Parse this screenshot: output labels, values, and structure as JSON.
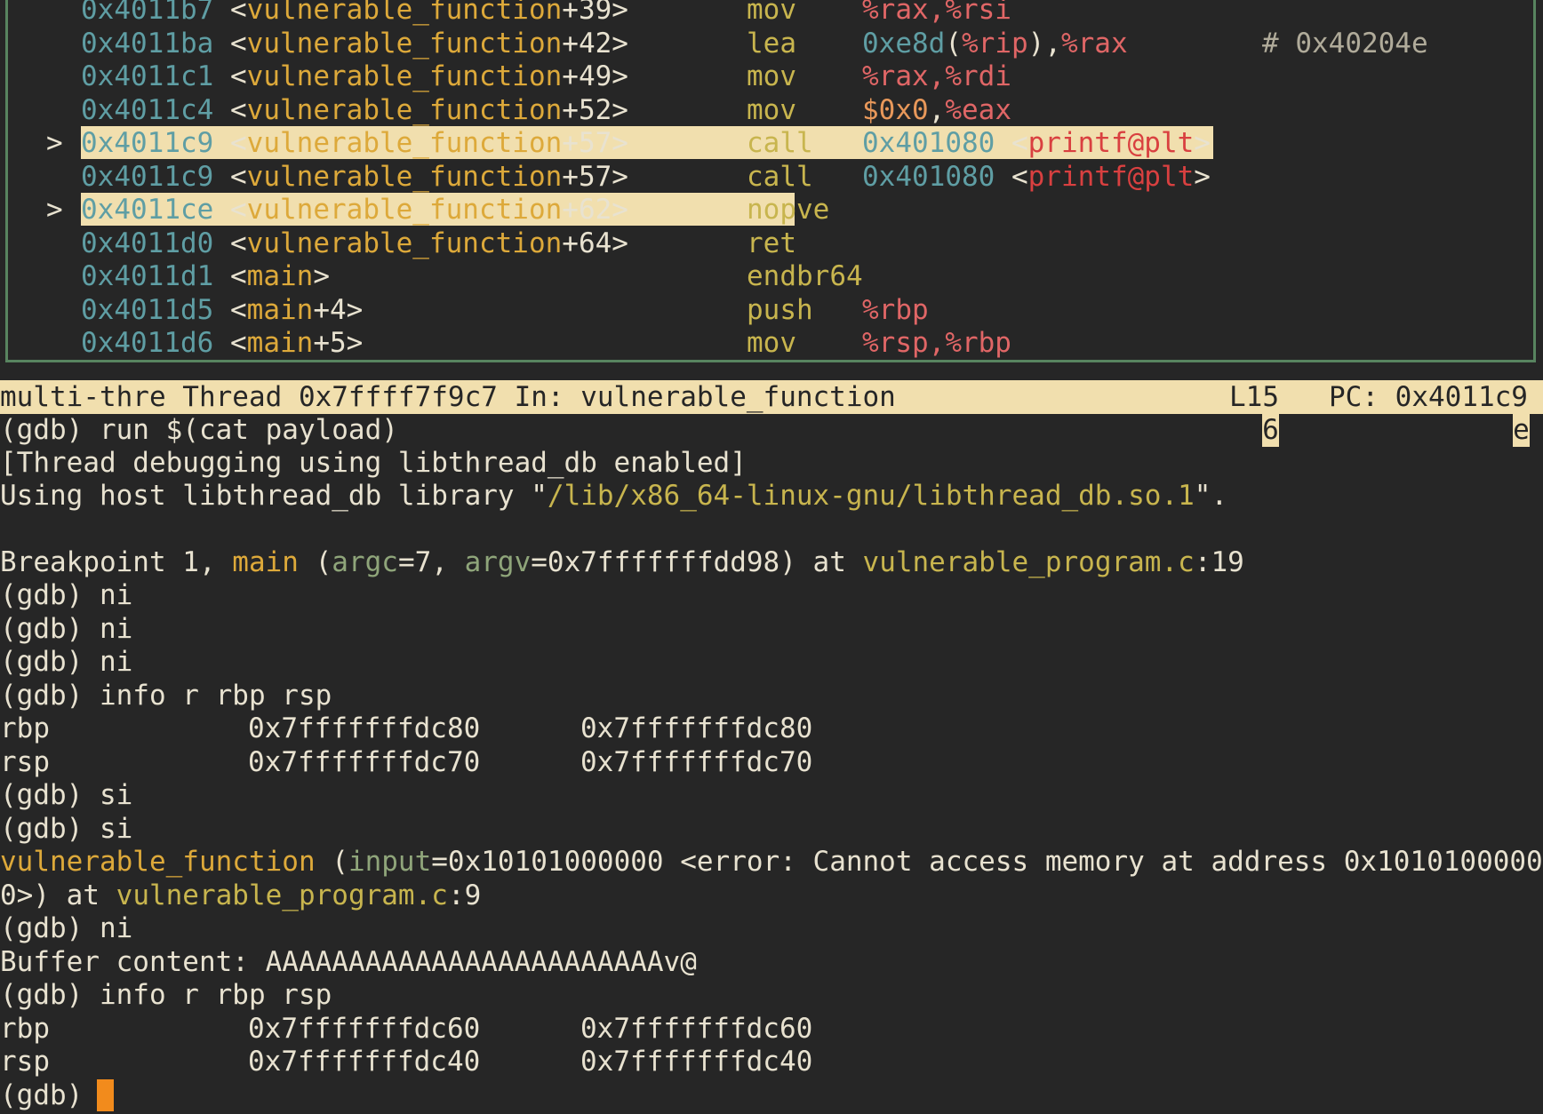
{
  "asm": {
    "rows": [
      {
        "marker": "",
        "addr": "0x4011b7",
        "sym": "vulnerable_function",
        "off": "+39",
        "mn": "mov",
        "op": "%rax,%rsi",
        "highlight": false,
        "cut": true
      },
      {
        "marker": "",
        "addr": "0x4011ba",
        "sym": "vulnerable_function",
        "off": "+42",
        "mn": "lea",
        "op_num": "0xe8d",
        "op_rest_a": "(",
        "op_reg_a": "%rip",
        "op_rest_b": "),",
        "op_reg_b": "%rax",
        "comment": "# 0x40204e",
        "highlight": false
      },
      {
        "marker": "",
        "addr": "0x4011c1",
        "sym": "vulnerable_function",
        "off": "+49",
        "mn": "mov",
        "op": "%rax,%rdi",
        "highlight": false
      },
      {
        "marker": "",
        "addr": "0x4011c4",
        "sym": "vulnerable_function",
        "off": "+52",
        "mn": "mov",
        "op_imm": "$0x0",
        "op_sep": ",",
        "op_reg": "%eax",
        "highlight": false
      },
      {
        "marker": ">",
        "addr": "0x4011c9",
        "sym": "vulnerable_function",
        "off": "+57",
        "mn": "call",
        "target": "0x401080",
        "plt": "printf@plt",
        "highlight": true
      },
      {
        "marker": "",
        "addr": "0x4011c9",
        "sym": "vulnerable_function",
        "off": "+57",
        "mn": "call",
        "target": "0x401080",
        "plt": "printf@plt",
        "highlight": false
      },
      {
        "marker": ">",
        "addr": "0x4011ce",
        "sym": "vulnerable_function",
        "off": "+62",
        "mn": "nop",
        "mn_tail": "ve",
        "highlight": true
      },
      {
        "marker": "",
        "addr": "0x4011d0",
        "sym": "vulnerable_function",
        "off": "+64",
        "mn": "ret",
        "highlight": false
      },
      {
        "marker": "",
        "addr": "0x4011d1",
        "sym": "main",
        "off": "",
        "mn": "endbr64",
        "highlight": false
      },
      {
        "marker": "",
        "addr": "0x4011d5",
        "sym": "main",
        "off": "+4",
        "mn": "push",
        "op": "%rbp",
        "highlight": false
      },
      {
        "marker": "",
        "addr": "0x4011d6",
        "sym": "main",
        "off": "+5",
        "mn": "mov",
        "op": "%rsp,%rbp",
        "highlight": false
      }
    ]
  },
  "status": {
    "left": "multi-thre Thread 0x7ffff7f9c7 In: vulnerable_function",
    "line": "L15",
    "pc": "PC: 0x4011c9",
    "wrap_line": "6",
    "wrap_pc": "e"
  },
  "terminal": {
    "l1": "(gdb) run $(cat payload)",
    "l2": "[Thread debugging using libthread_db enabled]",
    "l3a": "Using host libthread_db library \"",
    "l3b": "/lib/x86_64-linux-gnu/libthread_db.so.1",
    "l3c": "\".",
    "l5a": "Breakpoint 1, ",
    "l5b": "main",
    "l5c": " (",
    "l5d": "argc",
    "l5e": "=7, ",
    "l5f": "argv",
    "l5g": "=0x7fffffffdd98) at ",
    "l5h": "vulnerable_program.c",
    "l5i": ":19",
    "l6": "(gdb) ni",
    "l7": "(gdb) ni",
    "l8": "(gdb) ni",
    "l9": "(gdb) info r rbp rsp",
    "reg1": {
      "name": "rbp",
      "hex": "0x7fffffffdc80",
      "val": "0x7fffffffdc80"
    },
    "reg2": {
      "name": "rsp",
      "hex": "0x7fffffffdc70",
      "val": "0x7fffffffdc70"
    },
    "l12": "(gdb) si",
    "l13": "(gdb) si",
    "l14a": "vulnerable_function",
    "l14b": " (",
    "l14c": "input",
    "l14d": "=0x10101000000 <error: Cannot access memory at address 0x1010100000",
    "l15a": "0>) at ",
    "l15b": "vulnerable_program.c",
    "l15c": ":9",
    "l16": "(gdb) ni",
    "l17": "Buffer content: AAAAAAAAAAAAAAAAAAAAAAAAv@",
    "l18": "(gdb) info r rbp rsp",
    "reg3": {
      "name": "rbp",
      "hex": "0x7fffffffdc60",
      "val": "0x7fffffffdc60"
    },
    "reg4": {
      "name": "rsp",
      "hex": "0x7fffffffdc40",
      "val": "0x7fffffffdc40"
    },
    "prompt": "(gdb) "
  }
}
